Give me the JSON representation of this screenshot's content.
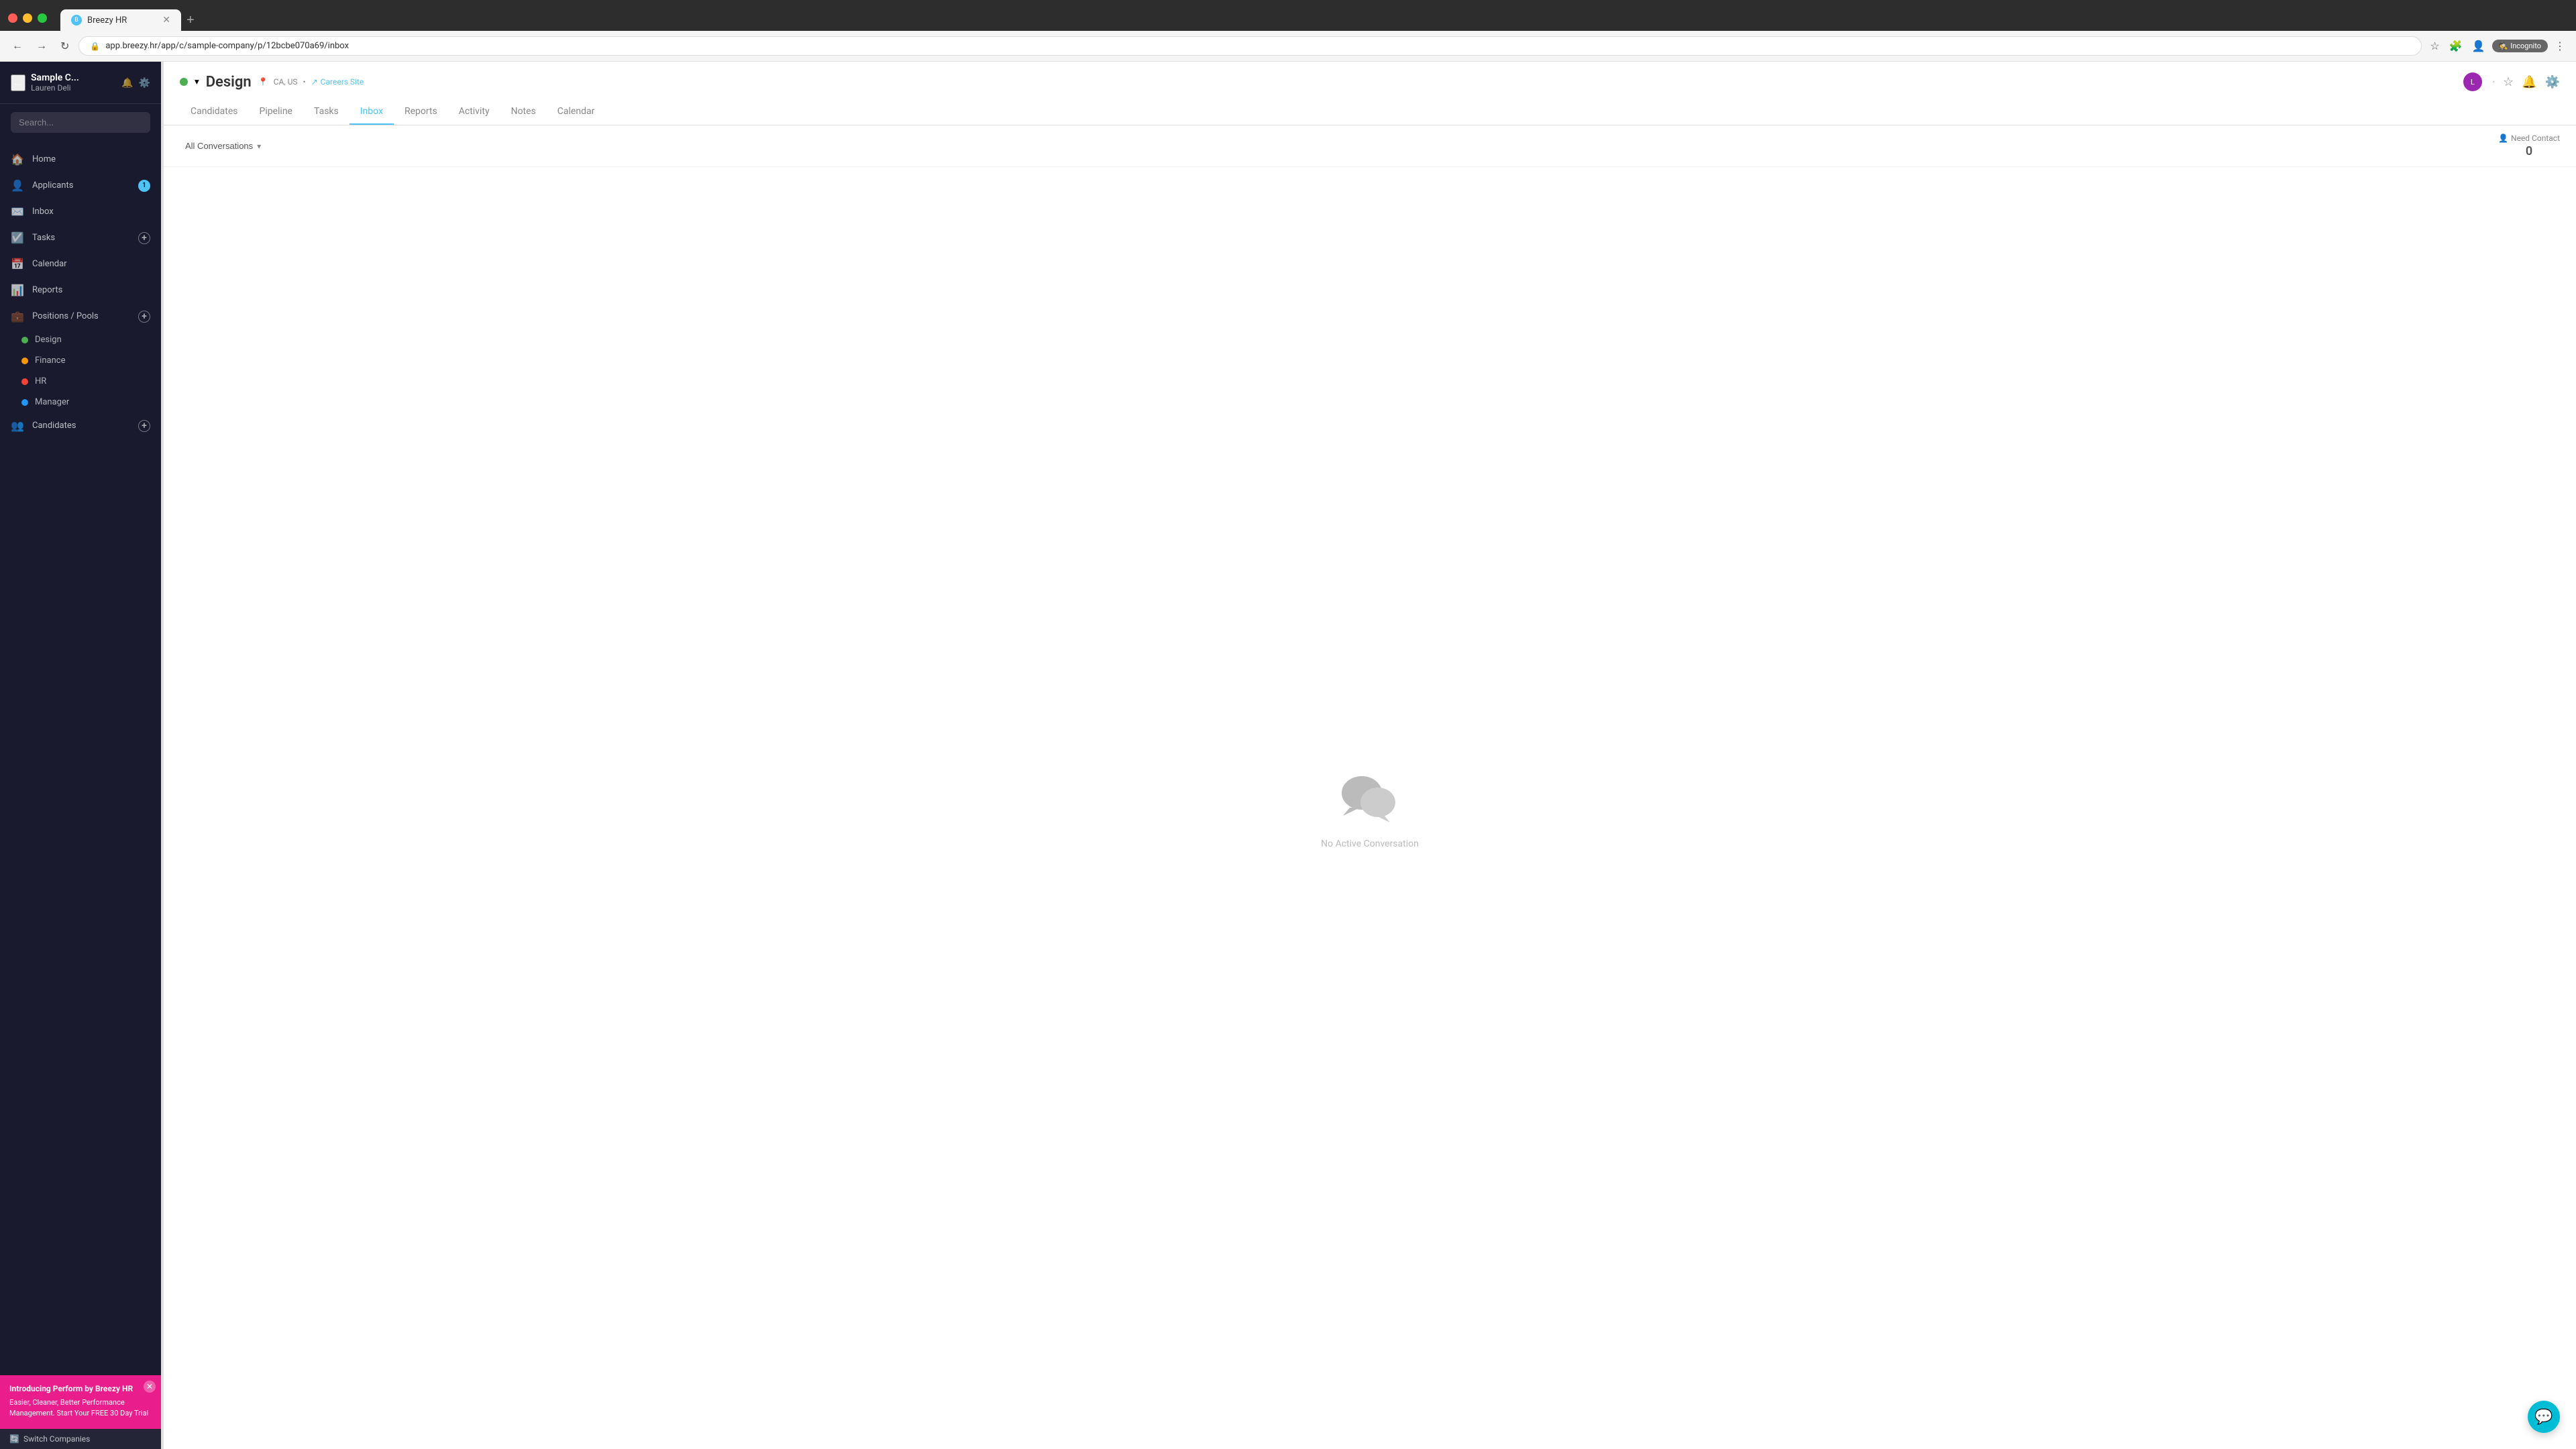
{
  "browser": {
    "tab_favicon": "B",
    "tab_title": "Breezy HR",
    "address": "app.breezy.hr/app/c/sample-company/p/12bcbe070a69/inbox",
    "incognito_label": "Incognito",
    "nav": {
      "back": "←",
      "forward": "→",
      "reload": "↻"
    }
  },
  "sidebar": {
    "back_label": "←",
    "company_name": "Sample C...",
    "user_name": "Lauren Deli",
    "search_placeholder": "Search...",
    "nav_items": [
      {
        "id": "home",
        "label": "Home",
        "icon": "🏠",
        "badge": null
      },
      {
        "id": "applicants",
        "label": "Applicants",
        "icon": "👤",
        "badge": "1"
      },
      {
        "id": "inbox",
        "label": "Inbox",
        "icon": "✉️",
        "badge": null
      },
      {
        "id": "tasks",
        "label": "Tasks",
        "icon": "☑️",
        "badge": "+"
      },
      {
        "id": "calendar",
        "label": "Calendar",
        "icon": "📅",
        "badge": null
      },
      {
        "id": "reports",
        "label": "Reports",
        "icon": "📊",
        "badge": null
      },
      {
        "id": "positions-pools",
        "label": "Positions / Pools",
        "icon": "💼",
        "badge": "+"
      }
    ],
    "positions": [
      {
        "label": "Design",
        "color": "green"
      },
      {
        "label": "Finance",
        "color": "orange"
      },
      {
        "label": "HR",
        "color": "red"
      },
      {
        "label": "Manager",
        "color": "blue"
      }
    ],
    "candidates_item": {
      "label": "Candidates",
      "icon": "👥",
      "badge": "+"
    },
    "promo": {
      "title": "Introducing Perform by Breezy HR",
      "subtitle": "Easier, Cleaner, Better Performance Management. Start Your FREE 30 Day Trial"
    },
    "switch_companies": "Switch Companies"
  },
  "page": {
    "title": "Design",
    "location": "CA, US",
    "careers_link": "Careers Site",
    "nav_items": [
      {
        "id": "candidates",
        "label": "Candidates",
        "active": false
      },
      {
        "id": "pipeline",
        "label": "Pipeline",
        "active": false
      },
      {
        "id": "tasks",
        "label": "Tasks",
        "active": false
      },
      {
        "id": "inbox",
        "label": "Inbox",
        "active": true
      },
      {
        "id": "reports",
        "label": "Reports",
        "active": false
      },
      {
        "id": "activity",
        "label": "Activity",
        "active": false
      },
      {
        "id": "notes",
        "label": "Notes",
        "active": false
      },
      {
        "id": "calendar",
        "label": "Calendar",
        "active": false
      }
    ]
  },
  "inbox": {
    "filter_label": "All Conversations",
    "need_contact_label": "Need Contact",
    "need_contact_count": "0",
    "empty_text": "No Active Conversation"
  }
}
